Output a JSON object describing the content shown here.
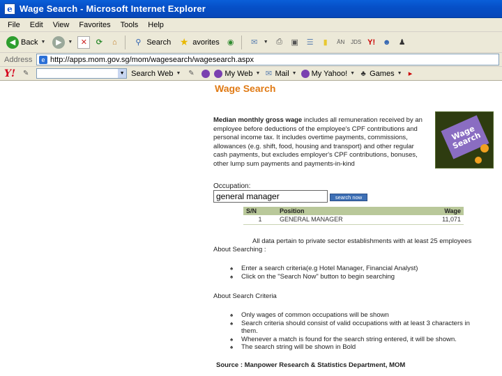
{
  "window": {
    "title": "Wage Search - Microsoft Internet Explorer"
  },
  "menu": [
    "File",
    "Edit",
    "View",
    "Favorites",
    "Tools",
    "Help"
  ],
  "toolbar": {
    "back": "Back",
    "search": "Search",
    "favorites": "avorites"
  },
  "address": {
    "label": "Address",
    "url": "http://apps.mom.gov.sg/mom/wagesearch/wagesearch.aspx"
  },
  "ytoolbar": {
    "search_button": "Search Web",
    "my_web": "My Web",
    "mail": "Mail",
    "my_yahoo": "My Yahoo!",
    "games": "Games"
  },
  "page": {
    "title": "Wage Search",
    "description_bold": "Median monthly gross wage",
    "description_rest": " includes all remuneration received by an employee before deductions of the employee's CPF contributions and personal income tax. It includes overtime payments, commissions, allowances (e.g. shift, food, housing and transport) and other regular cash payments, but excludes employer's CPF contributions, bonuses, other lump sum payments and payments-in-kind",
    "banner": {
      "line1": "Wage",
      "line2": "Search"
    },
    "occupation_label": "Occupation:",
    "occupation_value": "general manager",
    "search_button": "search now",
    "table_headers": [
      "S/N",
      "Position",
      "Wage"
    ],
    "table_rows": [
      {
        "sn": "1",
        "position": "GENERAL MANAGER",
        "wage": "11,071"
      }
    ],
    "note": "All data pertain to private sector establishments with at least 25 employees",
    "about_searching": "About Searching :",
    "searching_items": [
      "Enter a search criteria(e.g Hotel Manager, Financial Analyst)",
      "Click on the \"Search Now\" button to begin searching"
    ],
    "about_criteria": "About Search Criteria",
    "criteria_items": [
      "Only wages of common occupations will be shown",
      "Search criteria should consist of valid occupations with at least 3 characters in them.",
      "Whenever a match is found for the search string entered, it will be shown.",
      "The search string will be shown in Bold"
    ],
    "source": "Source : Manpower Research & Statistics Department, MOM"
  }
}
